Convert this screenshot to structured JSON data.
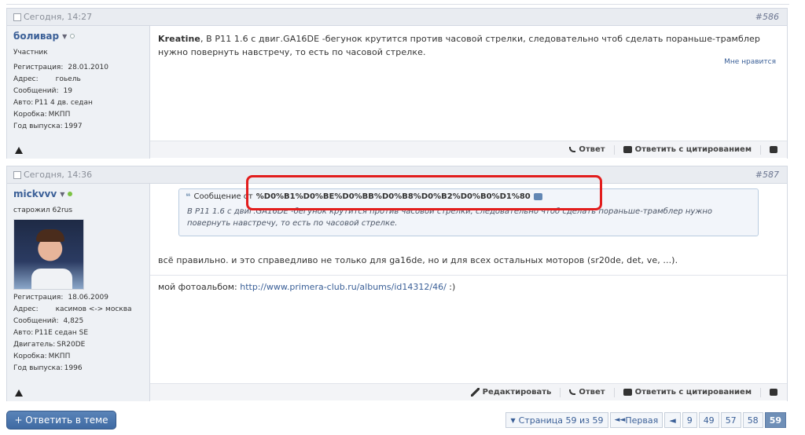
{
  "posts": [
    {
      "date": "Сегодня, 14:27",
      "number": "#586",
      "user": {
        "name": "боливар",
        "title": "Участник",
        "info": [
          {
            "label": "Регистрация:",
            "value": "28.01.2010"
          },
          {
            "label": "Адрес:",
            "value": "гоьель"
          },
          {
            "label": "Сообщений:",
            "value": "19"
          },
          {
            "label": "Авто:",
            "value": "P11 4 дв. седан"
          },
          {
            "label": "Коробка:",
            "value": "МКПП"
          },
          {
            "label": "Год выпуска:",
            "value": "1997"
          }
        ]
      },
      "message_author": "Kreatine",
      "message_text": ", В Р11 1.6 с двиг.GA16DE -бегунок крутится против часовой стрелки, следовательно чтоб сделать пораньше-трамблер нужно повернуть навстречу, то есть по часовой стрелке.",
      "like": "Мне нравится",
      "actions": {
        "reply": "Ответ",
        "quote": "Ответить с цитированием"
      }
    },
    {
      "date": "Сегодня, 14:36",
      "number": "#587",
      "user": {
        "name": "mickvvv",
        "title": "старожил 62rus",
        "info": [
          {
            "label": "Регистрация:",
            "value": "18.06.2009"
          },
          {
            "label": "Адрес:",
            "value": "касимов <-> москва"
          },
          {
            "label": "Сообщений:",
            "value": "4,825"
          },
          {
            "label": "Авто:",
            "value": "P11E седан SE"
          },
          {
            "label": "Двигатель:",
            "value": "SR20DE"
          },
          {
            "label": "Коробка:",
            "value": "МКПП"
          },
          {
            "label": "Год выпуска:",
            "value": "1996"
          }
        ]
      },
      "quote_prefix": "Сообщение от",
      "quote_author": "%D0%B1%D0%BE%D0%BB%D0%B8%D0%B2%D0%B0%D1%80",
      "quote_text": "В Р11 1.6 с двиг.GA16DE -бегунок крутится против часовой стрелки, следовательно чтоб сделать пораньше-трамблер нужно повернуть навстречу, то есть по часовой стрелке.",
      "message_text": "всё правильно. и это справедливо не только для ga16de, но и для всех остальных моторов (sr20de, det, ve, ...).",
      "signature_prefix": "мой фотоальбом:",
      "signature_link": "http://www.primera-club.ru/albums/id14312/46/",
      "signature_suffix": ":)",
      "actions": {
        "edit": "Редактировать",
        "reply": "Ответ",
        "quote": "Ответить с цитированием"
      }
    }
  ],
  "reply_button": "+ Ответить в теме",
  "pagination": {
    "page_of": "Страница 59 из 59",
    "first": "Первая",
    "prev": "◄",
    "pages": [
      "9",
      "49",
      "57",
      "58"
    ],
    "current": "59"
  },
  "colors": {
    "highlight": "#e21d1d",
    "link": "#3a5f97",
    "online": "#7bc242"
  }
}
